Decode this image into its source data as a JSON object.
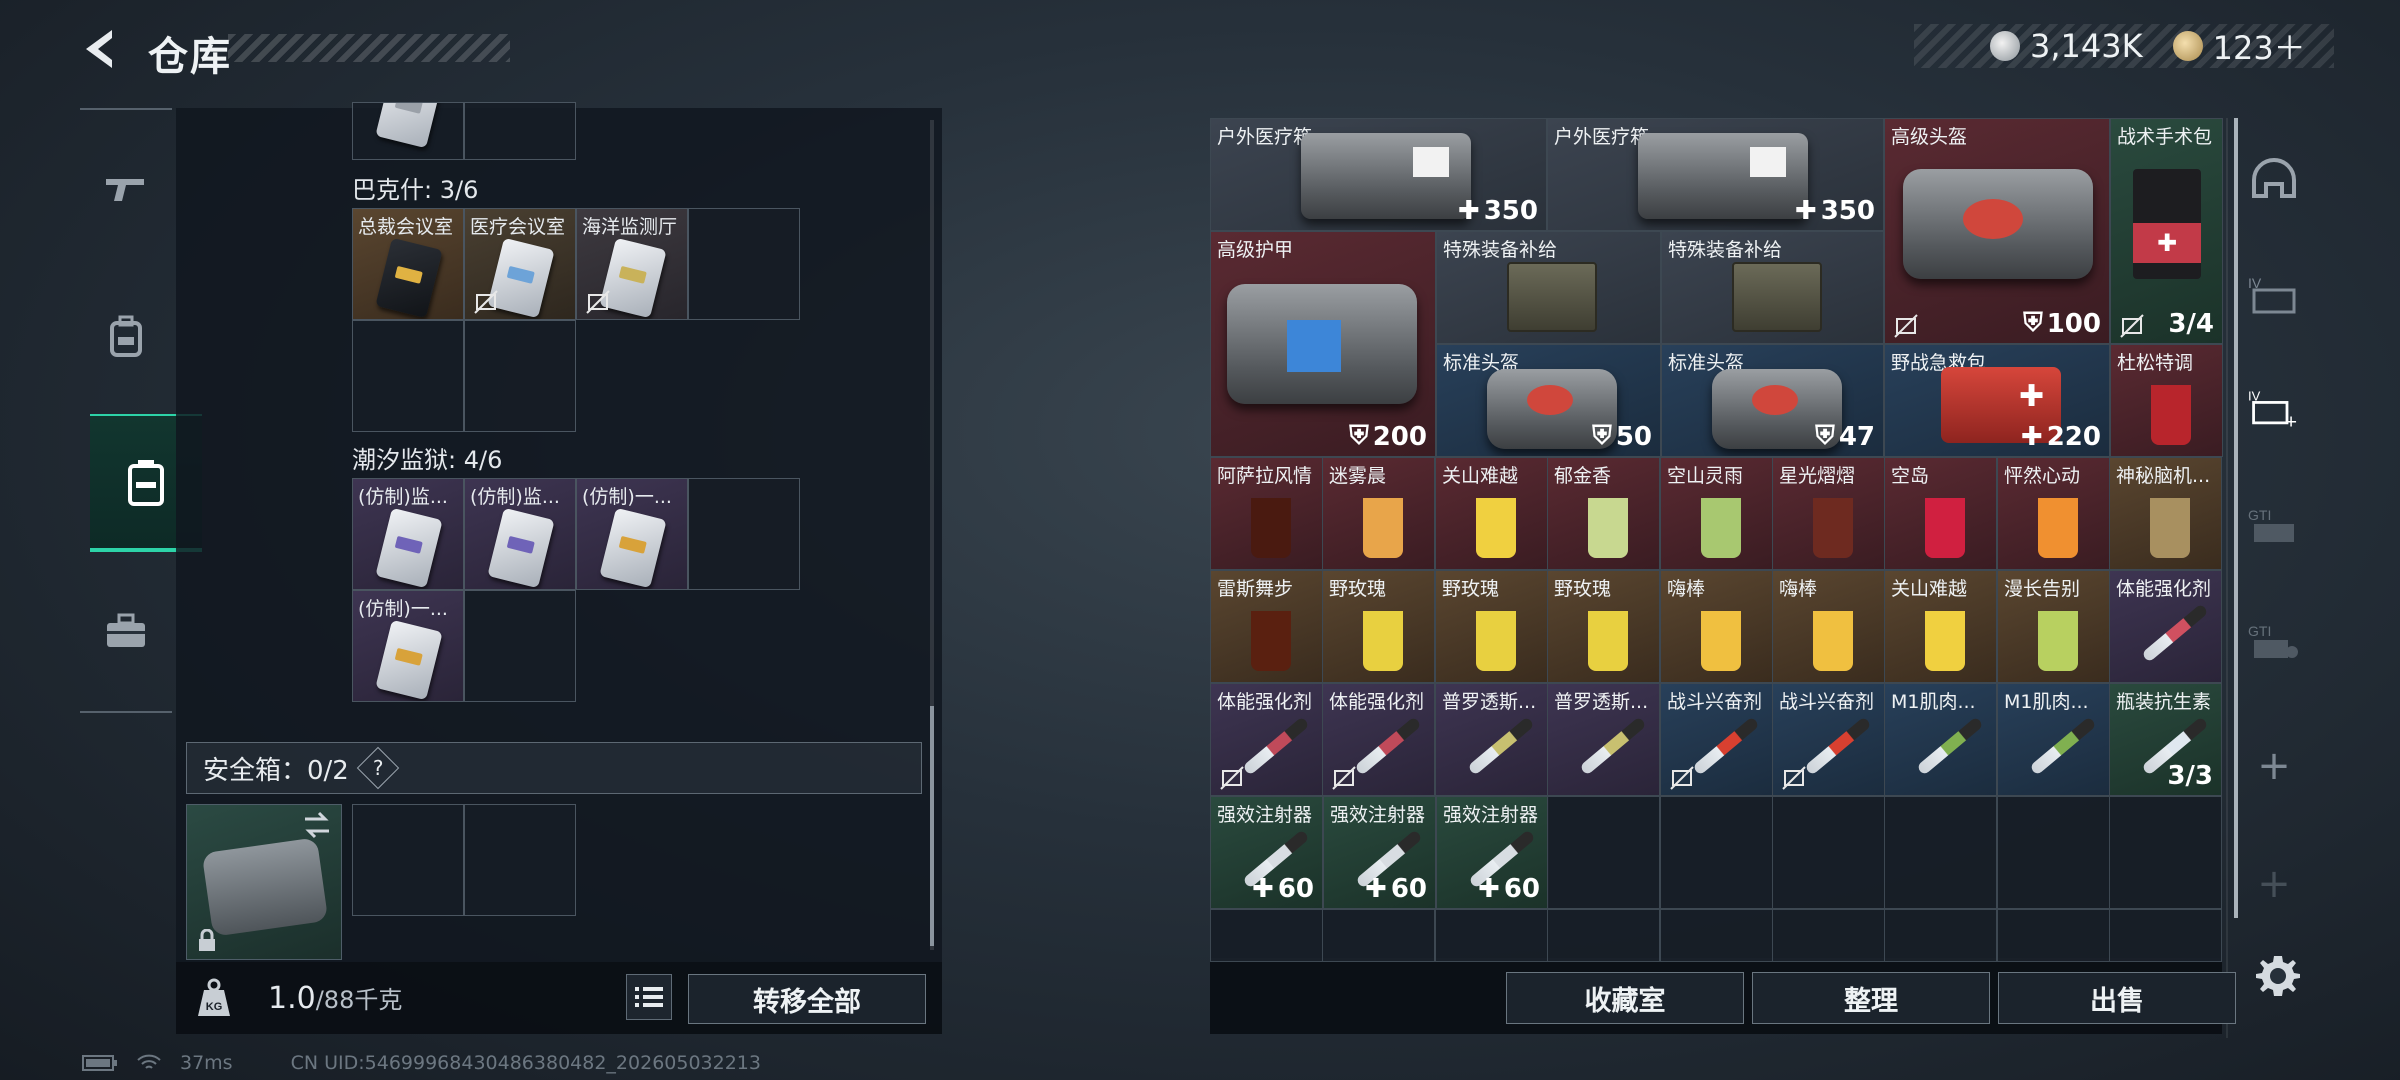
{
  "header": {
    "title": "仓库"
  },
  "currency": {
    "silver": "3,143K",
    "gold": "123＋"
  },
  "left": {
    "sections": [
      {
        "label": "巴克什: 3/6",
        "items": [
          "总裁会议室",
          "医疗会议室",
          "海洋监测厅"
        ]
      },
      {
        "label": "潮汐监狱: 4/6",
        "items": [
          "(仿制)监...",
          "(仿制)监...",
          "(仿制)一...",
          "(仿制)一..."
        ]
      }
    ],
    "safe_box_label": "安全箱：0/2",
    "safe_box_help": "?",
    "weight": "1.0",
    "weight_max": "/88千克",
    "transfer_all": "转移全部"
  },
  "status": {
    "ping": "37ms",
    "uid": "CN UID:54699968430486380482_202605032213"
  },
  "grid": {
    "r1": [
      {
        "name": "户外医疗箱",
        "value": "350"
      },
      {
        "name": "户外医疗箱",
        "value": "350"
      },
      {
        "name": "高级头盔",
        "value": "100"
      },
      {
        "name": "战术手术包",
        "value": "3/4"
      }
    ],
    "r2": [
      {
        "name": "高级护甲",
        "value": "200"
      },
      {
        "name": "特殊装备补给"
      },
      {
        "name": "特殊装备补给"
      }
    ],
    "r3": [
      {
        "name": "标准头盔",
        "value": "50"
      },
      {
        "name": "标准头盔",
        "value": "47"
      },
      {
        "name": "野战急救包",
        "value": "220"
      },
      {
        "name": "杜松特调"
      }
    ],
    "r4": [
      "阿萨拉风情",
      "迷雾晨",
      "关山难越",
      "郁金香",
      "空山灵雨",
      "星光熠熠",
      "空岛",
      "怦然心动",
      "神秘脑机..."
    ],
    "r5": [
      "雷斯舞步",
      "野玫瑰",
      "野玫瑰",
      "野玫瑰",
      "嗨棒",
      "嗨棒",
      "关山难越",
      "漫长告别",
      "体能强化剂"
    ],
    "r6": [
      "体能强化剂",
      "体能强化剂",
      "普罗透斯...",
      "普罗透斯...",
      "战斗兴奋剂",
      "战斗兴奋剂",
      "M1肌肉...",
      "M1肌肉...",
      "瓶装抗生素"
    ],
    "r6_value": "3/3",
    "r7": [
      {
        "name": "强效注射器",
        "value": "60"
      },
      {
        "name": "强效注射器",
        "value": "60"
      },
      {
        "name": "强效注射器",
        "value": "60"
      }
    ]
  },
  "bottom": {
    "collection": "收藏室",
    "sort": "整理",
    "sell": "出售"
  },
  "rail": {
    "plus1": "+",
    "plus2": "+"
  },
  "colors": {
    "accent": "#2dd3a8",
    "rare_red": "#5a2a32",
    "rare_green": "#2a4a3e",
    "rare_blue": "#28405a"
  }
}
